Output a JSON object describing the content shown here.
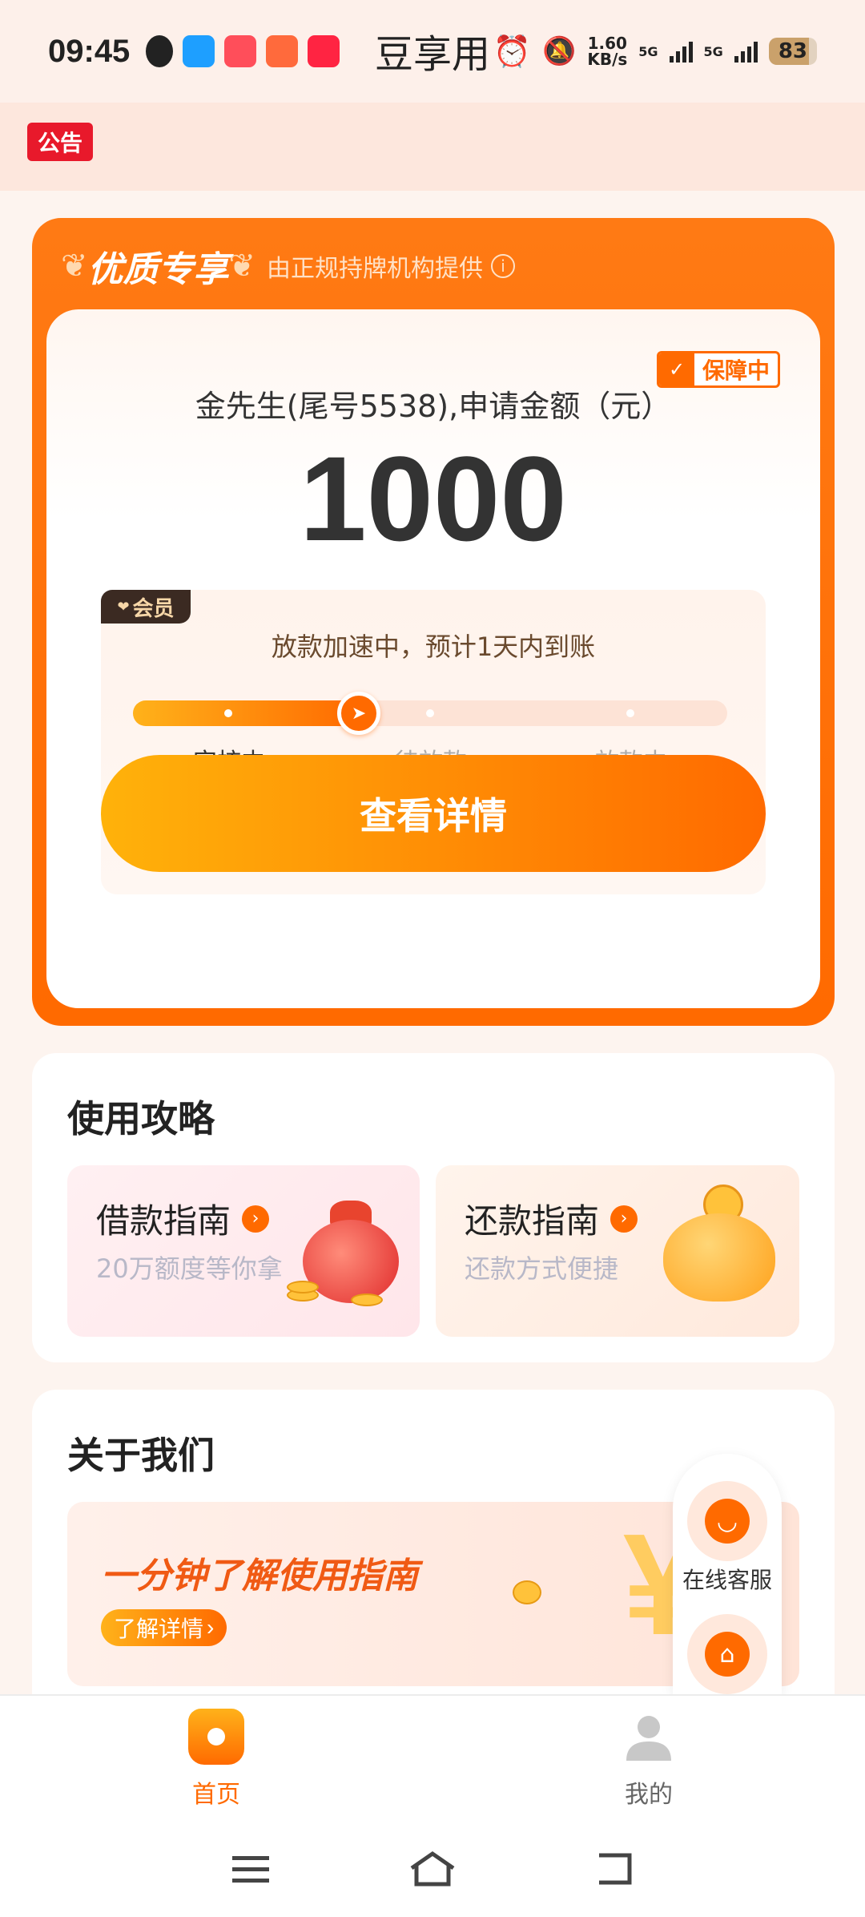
{
  "status_bar": {
    "time": "09:45",
    "app_title": "豆享用",
    "net_speed": "1.60\nKB/s",
    "net_speed_value": "1.60",
    "net_speed_unit": "KB/s",
    "signal_1": "5G",
    "signal_2": "5G",
    "battery": "83"
  },
  "notice": {
    "badge": "公告"
  },
  "premium": {
    "title": "优质专享",
    "subtitle": "由正规持牌机构提供",
    "guarantee": "保障中",
    "applicant": "金先生(尾号5538),申请金额（元）",
    "amount": "1000",
    "member_tag": "会员",
    "speed_text": "放款加速中，预计1天内到账",
    "progress": 0.38,
    "steps": [
      "审核中",
      "待放款",
      "放款中"
    ],
    "detail_button": "查看详情"
  },
  "guide": {
    "title": "使用攻略",
    "tiles": [
      {
        "title": "借款指南",
        "subtitle": "20万额度等你拿"
      },
      {
        "title": "还款指南",
        "subtitle": "还款方式便捷"
      }
    ]
  },
  "about": {
    "title": "关于我们",
    "banner_title": "一分钟了解使用指南",
    "banner_button": "了解详情",
    "banner_arrow": "›",
    "yen_symbol": "¥"
  },
  "float_service": {
    "label": "在线客服"
  },
  "bottom_nav": {
    "items": [
      {
        "label": "首页",
        "active": true
      },
      {
        "label": "我的",
        "active": false
      }
    ]
  },
  "colors": {
    "accent": "#ff6a00",
    "notice_red": "#e8192b"
  }
}
